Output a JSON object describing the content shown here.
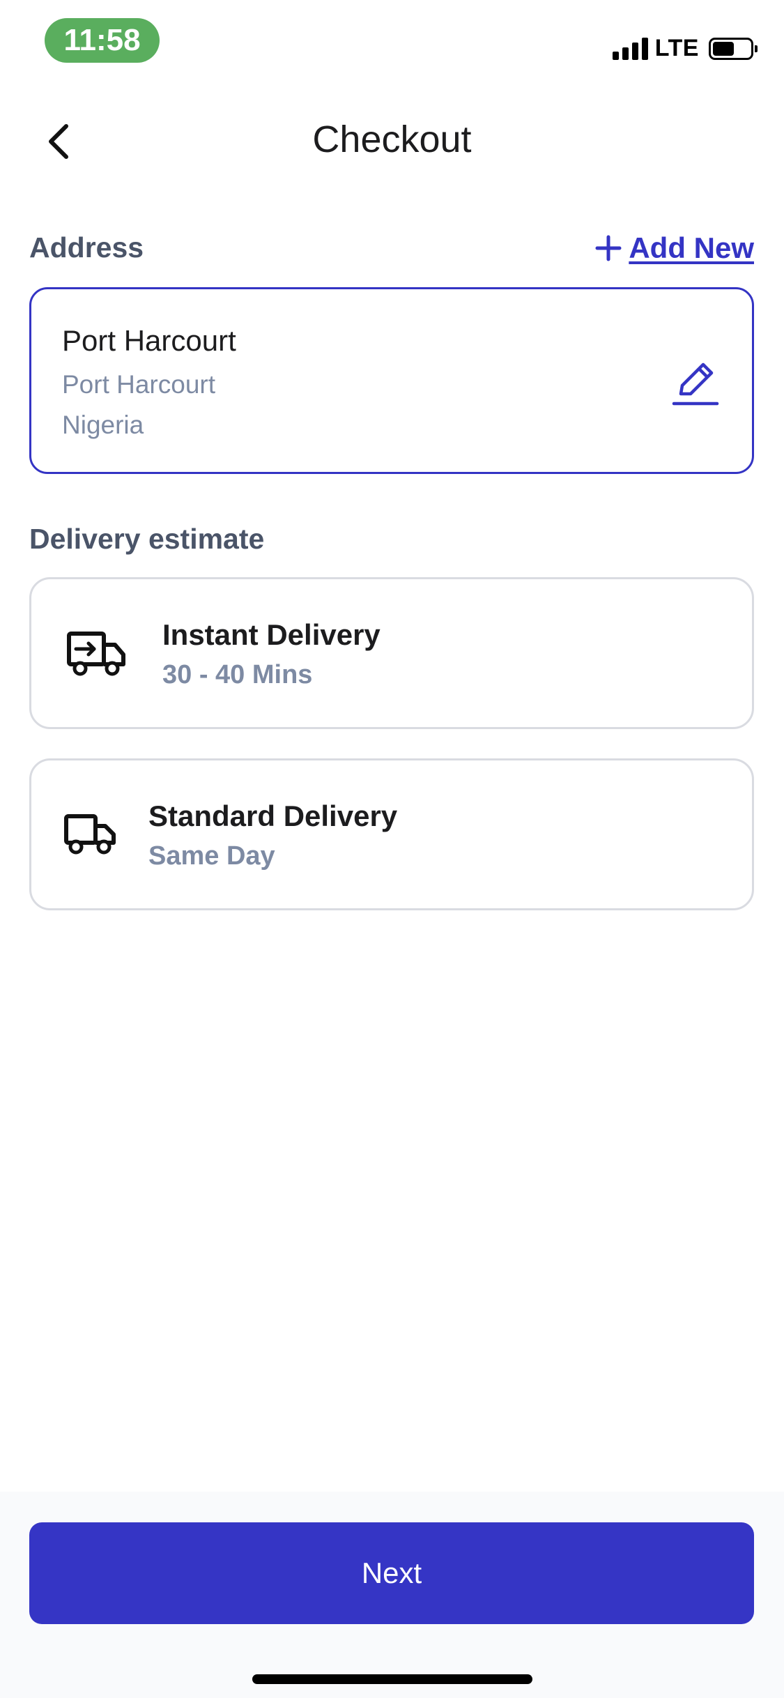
{
  "status_bar": {
    "time": "11:58",
    "network": "LTE",
    "icons": [
      "signal-icon",
      "battery-icon"
    ],
    "time_pill_color": "#5aae5e"
  },
  "header": {
    "title": "Checkout",
    "back_icon": "chevron-left-icon"
  },
  "address_section": {
    "label": "Address",
    "add_new_label": "Add New",
    "add_icon": "plus-icon",
    "selected": {
      "name": "Port Harcourt",
      "city": "Port Harcourt",
      "country": "Nigeria",
      "edit_icon": "pencil-icon"
    }
  },
  "delivery_section": {
    "label": "Delivery estimate",
    "options": [
      {
        "title": "Instant Delivery",
        "subtitle": "30 - 40 Mins",
        "icon": "fast-truck-icon"
      },
      {
        "title": "Standard Delivery",
        "subtitle": "Same Day",
        "icon": "truck-icon"
      }
    ]
  },
  "footer": {
    "next_label": "Next"
  },
  "colors": {
    "accent": "#3535c5",
    "muted_text": "#7d8aa3",
    "section_label": "#4a5468",
    "card_border": "#d9dbe1"
  }
}
